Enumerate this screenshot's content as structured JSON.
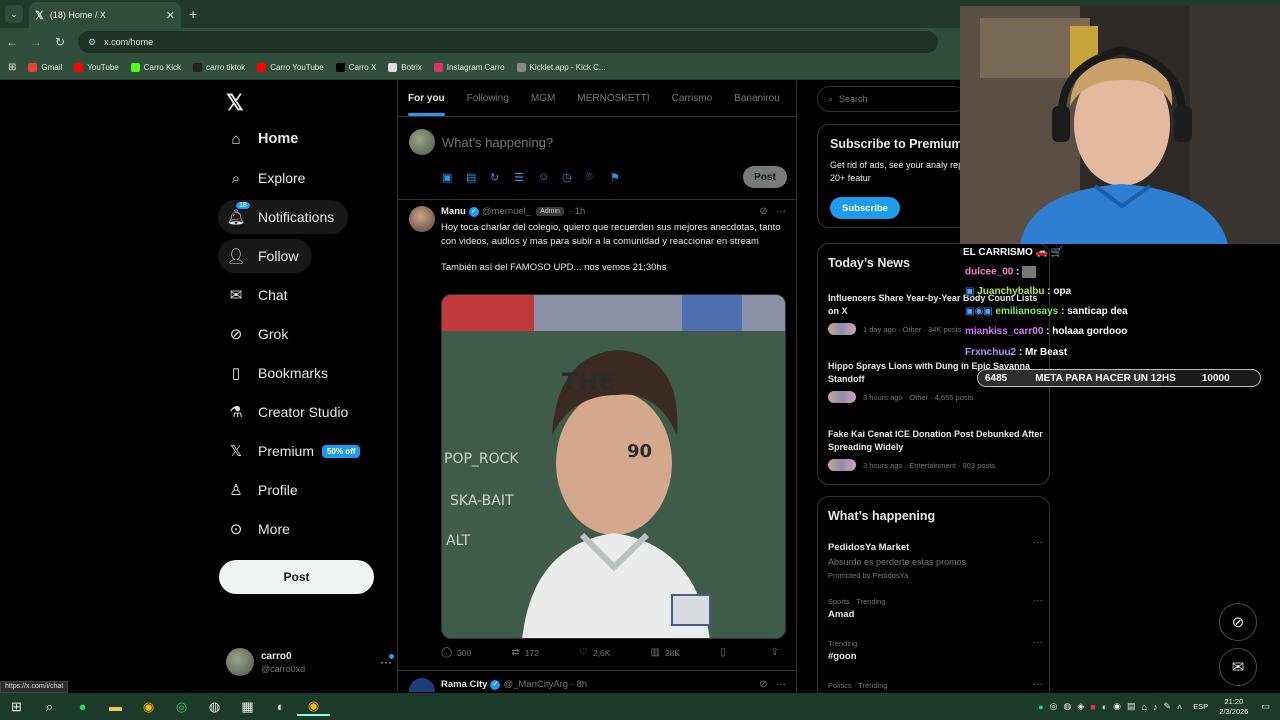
{
  "browser": {
    "tab_title": "(18) Home / X",
    "url": "x.com/home",
    "status_url": "https://x.com/i/chat",
    "bookmarks": [
      {
        "label": "Gmail",
        "color": "#ea4335"
      },
      {
        "label": "YouTube",
        "color": "#ff0000"
      },
      {
        "label": "Carro Kick",
        "color": "#53fc18"
      },
      {
        "label": "carro tiktok",
        "color": "#222222"
      },
      {
        "label": "Carro YouTube",
        "color": "#ff0000"
      },
      {
        "label": "Carro X",
        "color": "#000000"
      },
      {
        "label": "Botrix",
        "color": "#dddddd"
      },
      {
        "label": "Instagram Carro",
        "color": "#e1306c"
      },
      {
        "label": "Kicklet.app - Kick C...",
        "color": "#888888"
      }
    ]
  },
  "nav": {
    "items": [
      {
        "label": "Home",
        "icon": "home-icon"
      },
      {
        "label": "Explore",
        "icon": "search-icon"
      },
      {
        "label": "Notifications",
        "icon": "bell-icon",
        "badge": "18"
      },
      {
        "label": "Follow",
        "icon": "add-user-icon"
      },
      {
        "label": "Chat",
        "icon": "mail-icon"
      },
      {
        "label": "Grok",
        "icon": "grok-icon"
      },
      {
        "label": "Bookmarks",
        "icon": "bookmark-icon"
      },
      {
        "label": "Creator Studio",
        "icon": "flask-icon"
      },
      {
        "label": "Premium",
        "icon": "x-icon",
        "tag": "50% off"
      },
      {
        "label": "Profile",
        "icon": "person-icon"
      },
      {
        "label": "More",
        "icon": "more-circle-icon"
      }
    ],
    "post_label": "Post",
    "account": {
      "name": "carro0",
      "handle": "@carro0xd"
    }
  },
  "feed": {
    "tabs": [
      "For you",
      "Following",
      "MGM",
      "MERNOSKETTI",
      "Carrismo",
      "Bananirou"
    ],
    "compose": {
      "placeholder": "What’s happening?",
      "post_label": "Post"
    },
    "tweet": {
      "name": "Manu",
      "handle": "@mernuel_",
      "role": "Admin",
      "time": "1h",
      "text1": "Hoy toca charlar del colegio, quiero que recuerden sus mejores anecdotas, tanto con videos, audios y mas para subir a la comunidad y reaccionar en stream",
      "text2": "También así del FAMOSO UPD... nos vemos 21;30hs",
      "stats": {
        "replies": "300",
        "reposts": "172",
        "likes": "2,6K",
        "views": "28K"
      }
    },
    "tweet2": {
      "name": "Rama City",
      "handle": "@_ManCityArg",
      "time": "8h"
    }
  },
  "right": {
    "search_placeholder": "Search",
    "subscribe": {
      "title": "Subscribe to Premium",
      "desc": "Get rid of ads, see your analy replies and unlock 20+ featur",
      "button": "Subscribe"
    },
    "news_title": "Today’s News",
    "news": [
      {
        "headline": "Influencers Share Year-by-Year Body Count Lists on X",
        "meta": "1 day ago · Other · 34K posts"
      },
      {
        "headline": "Hippo Sprays Lions with Dung in Epic Savanna Standoff",
        "meta": "3 hours ago · Other · 4,655 posts"
      },
      {
        "headline": "Fake Kai Cenat ICE Donation Post Debunked After Spreading Widely",
        "meta": "3 hours ago · Entertainment · 903 posts"
      }
    ],
    "happening_title": "What’s happening",
    "trends": [
      {
        "context": "",
        "title": "PedidosYa Market",
        "sub": "Absurdo es perderte estas promos",
        "promo": "Promoted by PedidosYa"
      },
      {
        "context": "Sports · Trending",
        "title": "Amad"
      },
      {
        "context": "Trending",
        "title": "#goon"
      },
      {
        "context": "Politics · Trending",
        "title": ""
      }
    ]
  },
  "stream": {
    "chat_title": "EL CARRISMO 🚗 🛒",
    "chat": [
      {
        "user": "dulcee_00",
        "msg": "",
        "color": "#ff7ad9"
      },
      {
        "user": "Juanchybalbu",
        "msg": "opa",
        "color": "#b9e34a"
      },
      {
        "user": "emilianosays",
        "msg": "santicap dea",
        "color": "#7cf25c"
      },
      {
        "user": "miankiss_carr00",
        "msg": "holaaa gordooo",
        "color": "#d875ff"
      },
      {
        "user": "Frxnchuu2",
        "msg": "Mr Beast",
        "color": "#b58cff"
      }
    ],
    "goal": {
      "current": "6485",
      "label": "META PARA HACER UN 12HS",
      "target": "10000",
      "progress": 0.6485
    }
  },
  "taskbar": {
    "lang": "ESP",
    "time": "21:20",
    "date": "2/3/2026"
  }
}
